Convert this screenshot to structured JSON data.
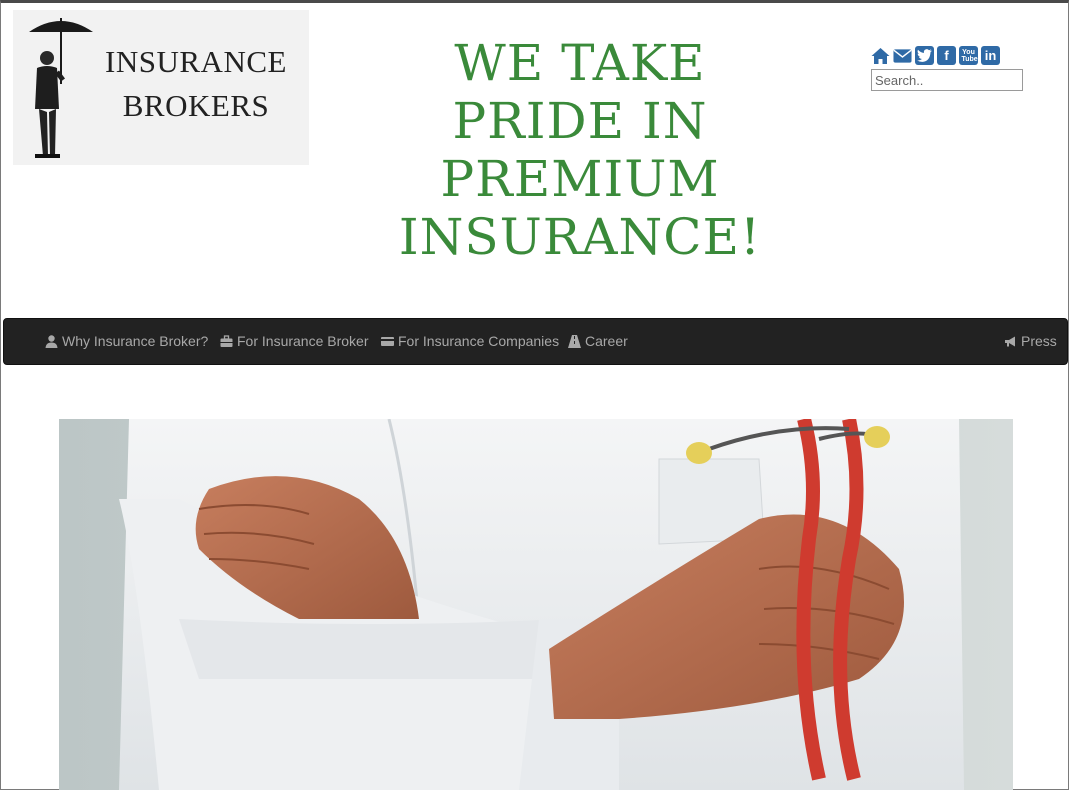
{
  "logo": {
    "line1": "INSURANCE",
    "line2": "BROKERS"
  },
  "headline": {
    "lines": [
      "WE TAKE",
      "PRIDE IN",
      "PREMIUM",
      "INSURANCE!"
    ]
  },
  "social": {
    "icons": [
      "home-icon",
      "mail-icon",
      "twitter-icon",
      "facebook-icon",
      "youtube-icon",
      "linkedin-icon"
    ],
    "youtube_text": "You Tube",
    "linkedin_text": "in",
    "facebook_text": "f"
  },
  "search": {
    "placeholder": "Search..",
    "value": ""
  },
  "nav": {
    "items": [
      {
        "label": "Why Insurance Broker?",
        "icon": "user-icon"
      },
      {
        "label": "For Insurance Broker",
        "icon": "briefcase-icon"
      },
      {
        "label": "For Insurance Companies",
        "icon": "credit-card-icon"
      },
      {
        "label": "Career",
        "icon": "road-icon"
      }
    ],
    "right": {
      "label": "Press",
      "icon": "bullhorn-icon"
    }
  },
  "colors": {
    "headline": "#3a8a3a",
    "social": "#2f6aa6",
    "navbar": "#222222",
    "nav_text": "#a8a8a8"
  },
  "hero": {
    "subject": "doctor-with-stethoscope-image"
  }
}
